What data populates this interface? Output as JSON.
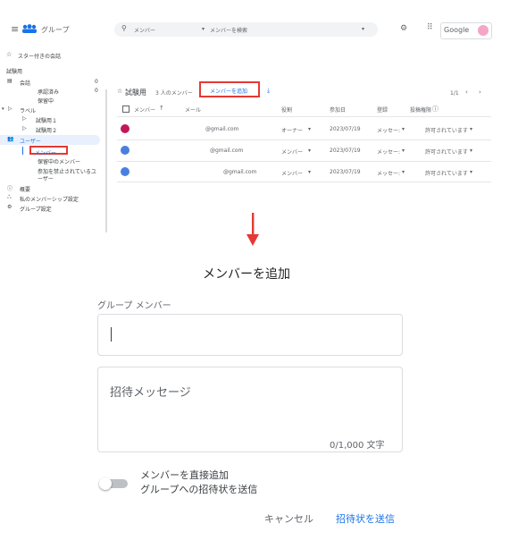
{
  "header": {
    "group_title": "グループ",
    "search_scope": "メンバー",
    "search_placeholder": "メンバーを検索",
    "google_label": "Google"
  },
  "sidebar": {
    "starred": "スター付きの会話",
    "section": "試験用",
    "items": {
      "conversations": "会話",
      "conversations_count": "0",
      "approved": "承認済み",
      "approved_count": "0",
      "pending": "保留中",
      "labels": "ラベル",
      "test1": "試験用１",
      "test2": "試験用２",
      "users": "ユーザー",
      "members": "メンバー",
      "pending_members": "保留中のメンバー",
      "banned_line1": "参加を禁止されているユ",
      "banned_line2": "ーザー",
      "about": "概要",
      "membership": "私のメンバーシップ設定",
      "group_settings": "グループ設定"
    }
  },
  "members": {
    "group_name": "試験用",
    "member_count": "3 人のメンバー",
    "add_button": "メンバーを追加",
    "pagination": "1/1",
    "columns": {
      "member": "メンバー",
      "email": "メール",
      "role": "役割",
      "joined": "参加日",
      "delivery": "登録",
      "posting": "投稿権限"
    },
    "rows": [
      {
        "email": "@gmail.com",
        "role": "オーナー",
        "joined": "2023/07/19",
        "delivery": "メッセー:",
        "posting": "許可されています"
      },
      {
        "email": "@gmail.com",
        "role": "メンバー",
        "joined": "2023/07/19",
        "delivery": "メッセー:",
        "posting": "許可されています"
      },
      {
        "email": "@gmail.com",
        "role": "メンバー",
        "joined": "2023/07/19",
        "delivery": "メッセー:",
        "posting": "許可されています"
      }
    ]
  },
  "dialog": {
    "title": "メンバーを追加",
    "group_members_label": "グループ メンバー",
    "invite_placeholder": "招待メッセージ",
    "char_count": "0/1,000 文字",
    "toggle_line1": "メンバーを直接追加",
    "toggle_line2": "グループへの招待状を送信",
    "cancel": "キャンセル",
    "send": "招待状を送信"
  },
  "colors": {
    "highlight": "#e53935",
    "accent": "#1a73e8",
    "arrow": "#e53935"
  }
}
